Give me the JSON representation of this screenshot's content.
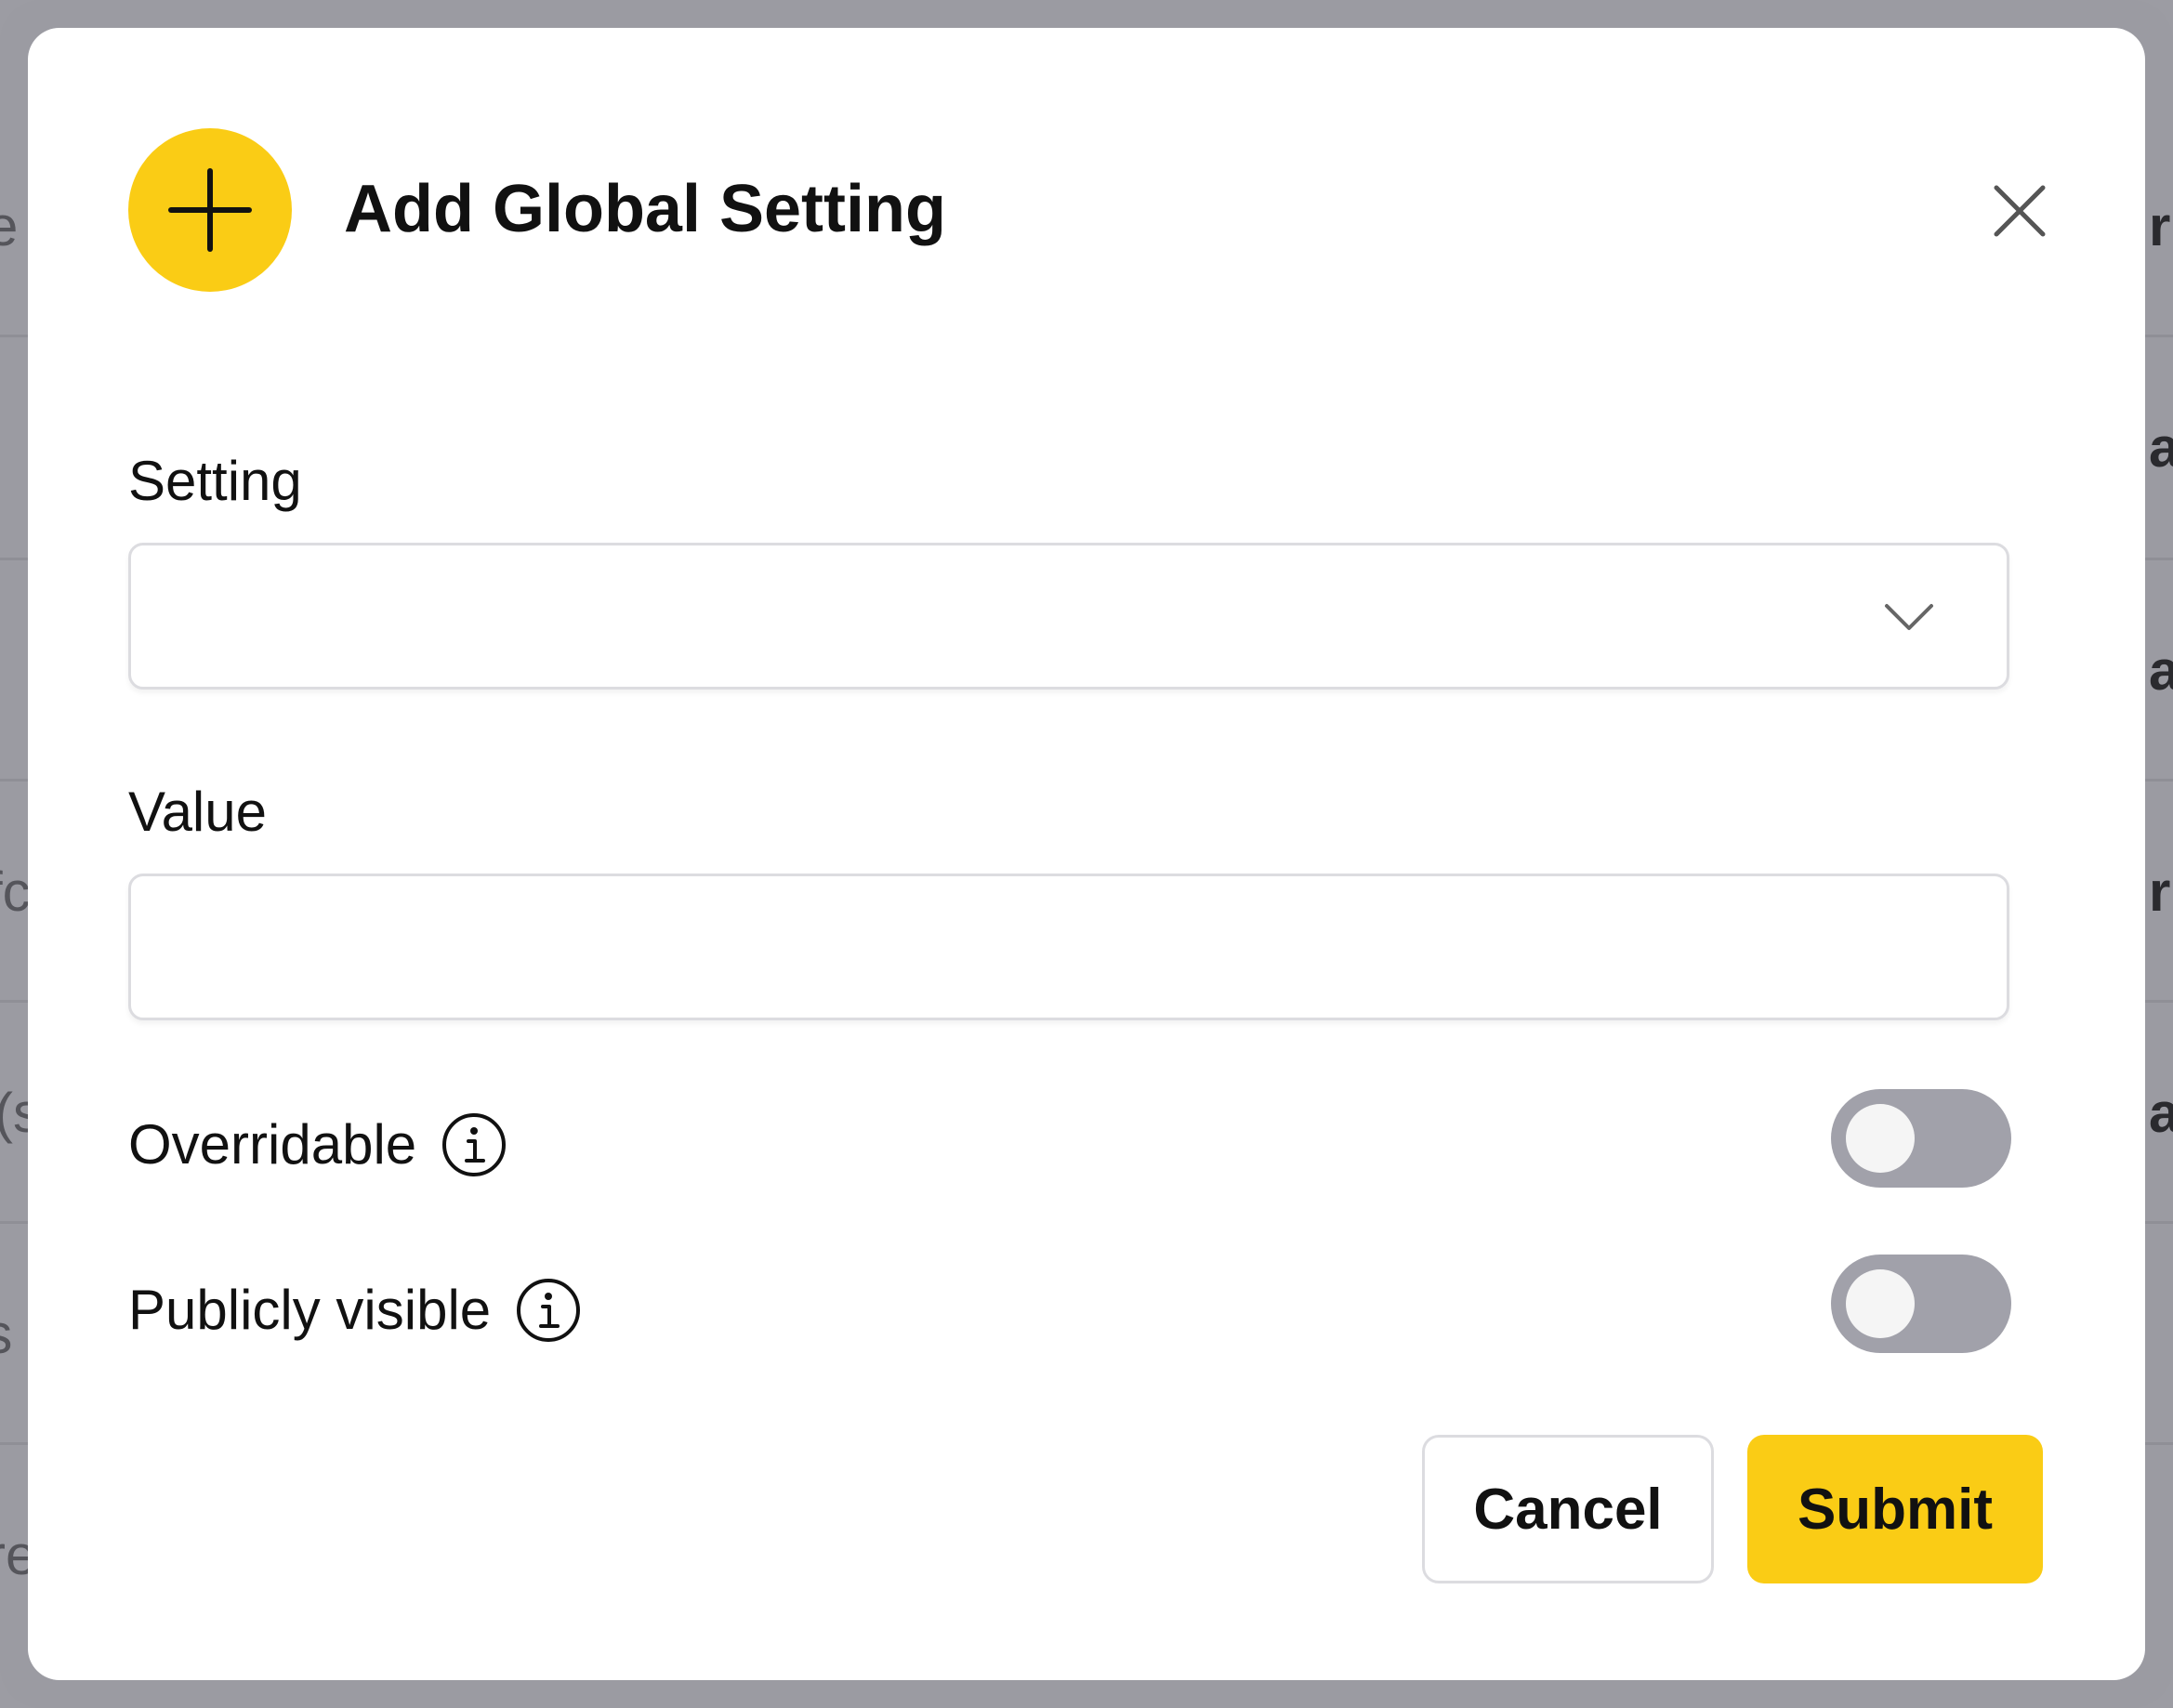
{
  "colors": {
    "accent": "#facc15",
    "overlay": "#9c9ca3",
    "toggle_off": "#a1a1aa",
    "border": "#dcdce0"
  },
  "background": {
    "left_fragments": [
      "e",
      "fc",
      "(s",
      "is",
      "re"
    ],
    "right_fragments": [
      "ru",
      "a",
      "a",
      "ru",
      "a"
    ]
  },
  "modal": {
    "header_icon": "plus-icon",
    "title": "Add Global Setting",
    "close_icon": "close-icon",
    "setting": {
      "label": "Setting",
      "selected_value": "",
      "icon": "chevron-down-icon"
    },
    "value": {
      "label": "Value",
      "current_value": ""
    },
    "overridable": {
      "label": "Overridable",
      "icon": "info-icon",
      "enabled": false
    },
    "publicly_visible": {
      "label": "Publicly visible",
      "icon": "info-icon",
      "enabled": false
    },
    "buttons": {
      "cancel_label": "Cancel",
      "submit_label": "Submit"
    }
  }
}
